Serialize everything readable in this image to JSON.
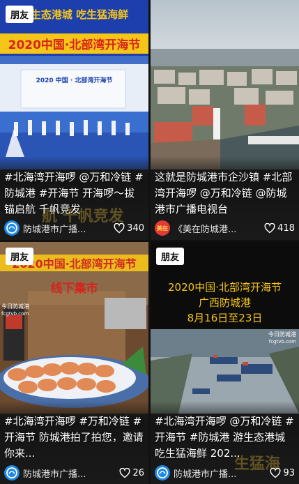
{
  "badge_label": "朋友",
  "cards": [
    {
      "banner_top": "吃生态港城  吃生猛海鲜",
      "banner_title": "2020中国·北部湾开海节",
      "stage_title": "2020 中国 · 北部湾开海节",
      "caption": "#北海湾开海啰 @万和冷链 #防城港 #开海节 开海啰～拔锚启航 千帆竞发",
      "author": "防城港市广播...",
      "likes": "340"
    },
    {
      "caption": "这就是防城港市企沙镇 #北部湾开海啰 @万和冷链 @防城港市广播电视台",
      "author": "《美在防城港...",
      "likes": "418",
      "avatar_text": "美在"
    },
    {
      "banner_title": "2020中国·北部湾开海节",
      "banner_sub": "线下集市",
      "logo_text": "今日防城港",
      "logo_url": "fcgtvb.com",
      "caption": "#北海湾开海啰 #万和冷链 #开海节 防城港拍了拍您，邀请你来...",
      "author": "防城港市广播...",
      "likes": "26"
    },
    {
      "title_line1": "2020中国·北部湾开海节",
      "title_line2": "广西防城港",
      "title_line3": "8月16日至23日",
      "logo_text": "今日防城港",
      "logo_url": "fcgtvb.com",
      "caption": "#北海湾开海啰 @万和冷链 #开海节 #防城港 游生态港城 吃生猛海鲜 202...",
      "author": "防城港市广播...",
      "likes": "93"
    }
  ],
  "colors": {
    "accent_yellow": "#f5c518",
    "avatar_blue": "#1e88e5",
    "background": "#111111"
  },
  "icons": {
    "like": "heart-outline-icon",
    "author_logo": "fcg-logo-icon"
  }
}
